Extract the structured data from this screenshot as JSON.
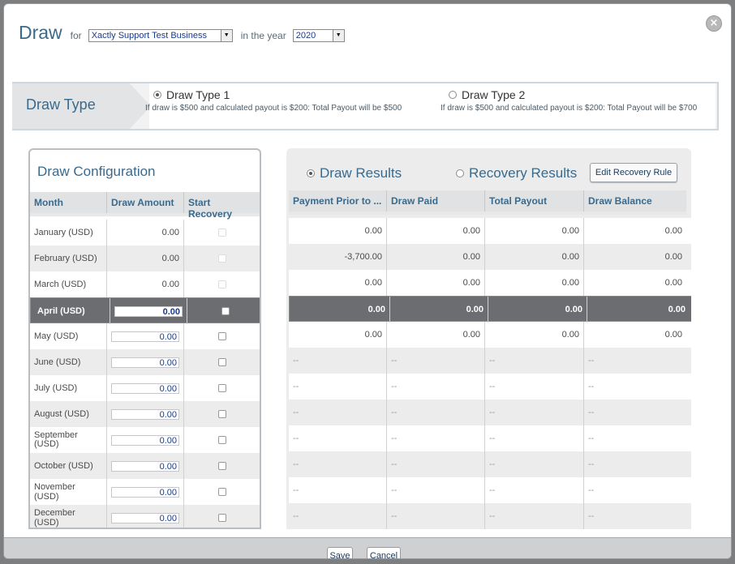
{
  "header": {
    "title": "Draw",
    "for_label": "for",
    "business": "Xactly Support Test Business",
    "year_label": "in the year",
    "year": "2020"
  },
  "draw_type": {
    "label": "Draw Type",
    "options": [
      {
        "label": "Draw Type 1",
        "desc": "If draw is $500 and calculated payout is $200: Total Payout will be $500",
        "selected": true
      },
      {
        "label": "Draw Type 2",
        "desc": "If draw is $500 and calculated payout is $200: Total Payout will be $700",
        "selected": false
      }
    ]
  },
  "config": {
    "title": "Draw Configuration",
    "columns": [
      "Month",
      "Draw Amount",
      "Start Recovery"
    ]
  },
  "results": {
    "tab_draw": "Draw Results",
    "tab_recovery": "Recovery Results",
    "edit_button": "Edit Recovery Rule",
    "columns": [
      "Payment Prior to ...",
      "Draw Paid",
      "Total Payout",
      "Draw Balance"
    ]
  },
  "rows": [
    {
      "month": "January (USD)",
      "amount": "0.00",
      "editable": false,
      "r": [
        "0.00",
        "0.00",
        "0.00",
        "0.00"
      ]
    },
    {
      "month": "February (USD)",
      "amount": "0.00",
      "editable": false,
      "r": [
        "-3,700.00",
        "0.00",
        "0.00",
        "0.00"
      ]
    },
    {
      "month": "March (USD)",
      "amount": "0.00",
      "editable": false,
      "r": [
        "0.00",
        "0.00",
        "0.00",
        "0.00"
      ]
    },
    {
      "month": "April (USD)",
      "amount": "0.00",
      "editable": true,
      "selected": true,
      "r": [
        "0.00",
        "0.00",
        "0.00",
        "0.00"
      ]
    },
    {
      "month": "May (USD)",
      "amount": "0.00",
      "editable": true,
      "r": [
        "0.00",
        "0.00",
        "0.00",
        "0.00"
      ]
    },
    {
      "month": "June (USD)",
      "amount": "0.00",
      "editable": true,
      "r": [
        "--",
        "--",
        "--",
        "--"
      ]
    },
    {
      "month": "July (USD)",
      "amount": "0.00",
      "editable": true,
      "r": [
        "--",
        "--",
        "--",
        "--"
      ]
    },
    {
      "month": "August (USD)",
      "amount": "0.00",
      "editable": true,
      "r": [
        "--",
        "--",
        "--",
        "--"
      ]
    },
    {
      "month": "September (USD)",
      "amount": "0.00",
      "editable": true,
      "r": [
        "--",
        "--",
        "--",
        "--"
      ]
    },
    {
      "month": "October (USD)",
      "amount": "0.00",
      "editable": true,
      "r": [
        "--",
        "--",
        "--",
        "--"
      ]
    },
    {
      "month": "November (USD)",
      "amount": "0.00",
      "editable": true,
      "r": [
        "--",
        "--",
        "--",
        "--"
      ]
    },
    {
      "month": "December (USD)",
      "amount": "0.00",
      "editable": true,
      "r": [
        "--",
        "--",
        "--",
        "--"
      ]
    }
  ],
  "footer": {
    "save": "Save",
    "cancel": "Cancel"
  },
  "colors": {
    "accent": "#3a6a8c",
    "selected_row": "#6c6d70"
  }
}
